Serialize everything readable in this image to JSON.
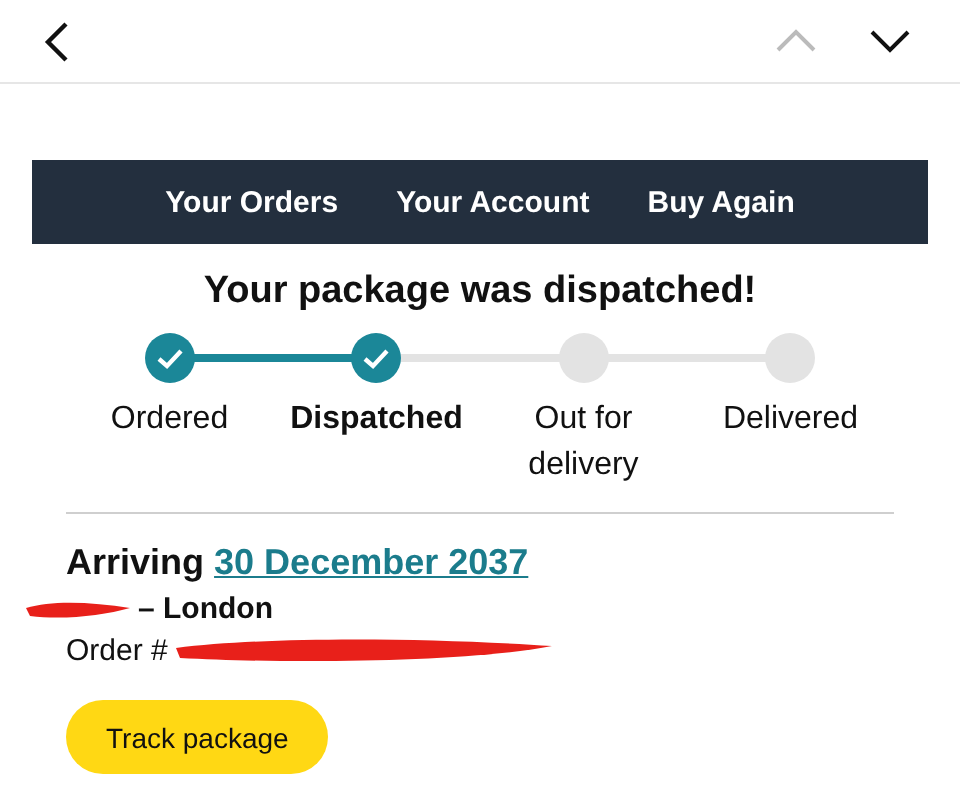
{
  "top_bar": {
    "previous_disabled": true,
    "next_disabled": false
  },
  "nav": [
    "Your Orders",
    "Your Account",
    "Buy Again"
  ],
  "title": "Your package was dispatched!",
  "steps": [
    {
      "label": "Ordered",
      "completed": true,
      "selected": false
    },
    {
      "label": "Dispatched",
      "completed": true,
      "selected": true
    },
    {
      "label": "Out for delivery",
      "completed": false,
      "selected": false
    },
    {
      "label": "Delivered",
      "completed": false,
      "selected": false
    }
  ],
  "arriving": {
    "label": "Arriving",
    "date": "30 December 2037"
  },
  "address": "– London",
  "order_label": "Order #",
  "button": "Track package"
}
